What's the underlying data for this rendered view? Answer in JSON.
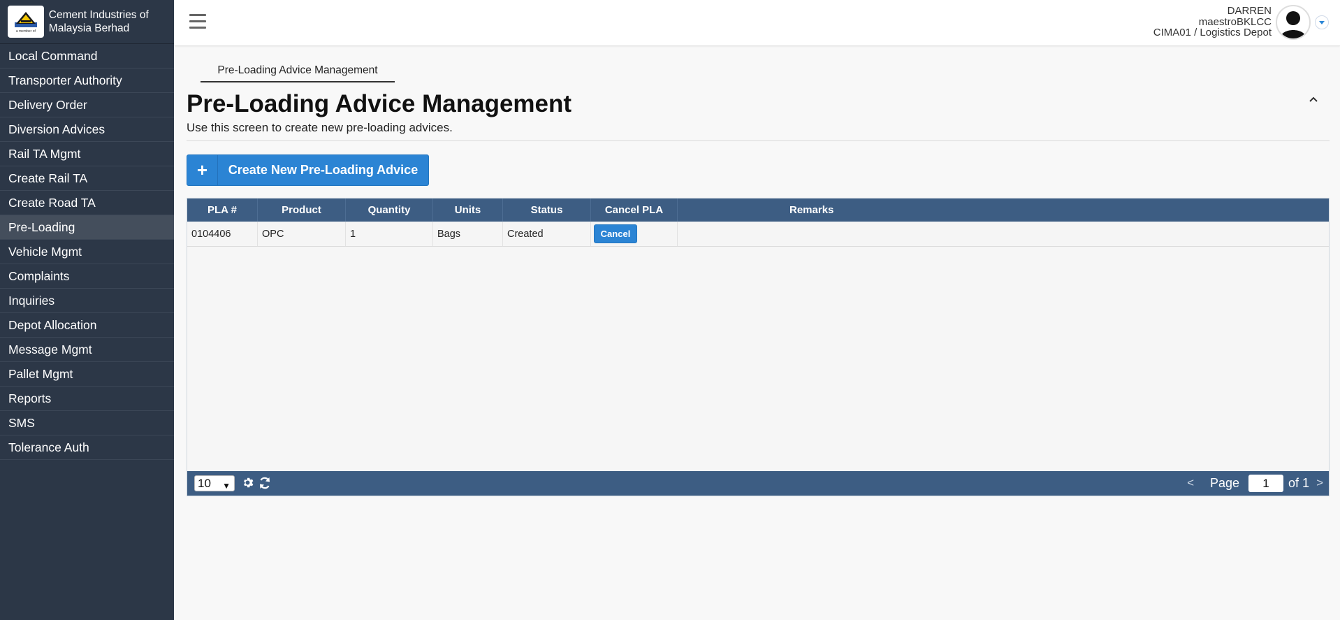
{
  "brand": {
    "name": "Cement Industries of Malaysia Berhad",
    "logo_tagline": "a member of"
  },
  "sidebar": {
    "items": [
      {
        "label": "Local Command"
      },
      {
        "label": "Transporter Authority"
      },
      {
        "label": "Delivery Order"
      },
      {
        "label": "Diversion Advices"
      },
      {
        "label": "Rail TA Mgmt"
      },
      {
        "label": "Create Rail TA"
      },
      {
        "label": "Create Road TA"
      },
      {
        "label": "Pre-Loading",
        "active": true
      },
      {
        "label": "Vehicle Mgmt"
      },
      {
        "label": "Complaints"
      },
      {
        "label": "Inquiries"
      },
      {
        "label": "Depot Allocation"
      },
      {
        "label": "Message Mgmt"
      },
      {
        "label": "Pallet Mgmt"
      },
      {
        "label": "Reports"
      },
      {
        "label": "SMS"
      },
      {
        "label": "Tolerance Auth"
      }
    ]
  },
  "user": {
    "name": "DARREN",
    "account": "maestroBKLCC",
    "location": "CIMA01 / Logistics Depot"
  },
  "main": {
    "tab": "Pre-Loading Advice Management",
    "title": "Pre-Loading Advice Management",
    "description": "Use this screen to create new pre-loading advices.",
    "create_button": "Create New Pre-Loading Advice",
    "create_icon": "+"
  },
  "grid": {
    "columns": [
      "PLA #",
      "Product",
      "Quantity",
      "Units",
      "Status",
      "Cancel PLA",
      "Remarks"
    ],
    "rows": [
      {
        "pla": "0104406",
        "product": "OPC",
        "quantity": "1",
        "units": "Bags",
        "status": "Created",
        "cancel": "Cancel",
        "remarks": ""
      }
    ],
    "pager": {
      "page_size": "10",
      "page_label": "Page",
      "page": "1",
      "of_label": "of 1",
      "prev": "<",
      "next": ">"
    }
  },
  "colors": {
    "sidebar": "#2c3747",
    "header": "#3d5d83",
    "accent": "#2b84d4"
  }
}
